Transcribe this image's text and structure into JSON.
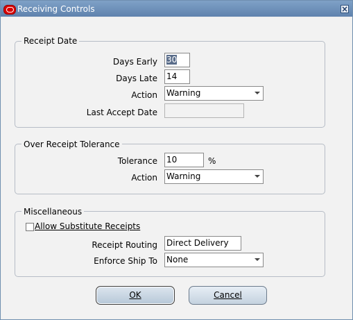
{
  "window": {
    "title": "Receiving Controls",
    "close_icon": "close-icon"
  },
  "receipt_date": {
    "title": "Receipt Date",
    "days_early_label": "Days Early",
    "days_early_value": "30",
    "days_late_label": "Days Late",
    "days_late_value": "14",
    "action_label": "Action",
    "action_value": "Warning",
    "last_accept_date_label": "Last Accept Date",
    "last_accept_date_value": ""
  },
  "over_receipt_tolerance": {
    "title": "Over Receipt Tolerance",
    "tolerance_label": "Tolerance",
    "tolerance_value": "10",
    "tolerance_unit": "%",
    "action_label": "Action",
    "action_value": "Warning"
  },
  "miscellaneous": {
    "title": "Miscellaneous",
    "allow_substitute_receipts_label": "Allow Substitute Receipts",
    "allow_substitute_receipts_checked": false,
    "receipt_routing_label": "Receipt Routing",
    "receipt_routing_value": "Direct Delivery",
    "enforce_ship_to_label": "Enforce Ship To",
    "enforce_ship_to_value": "None"
  },
  "buttons": {
    "ok_label": "OK",
    "cancel_label": "Cancel"
  }
}
